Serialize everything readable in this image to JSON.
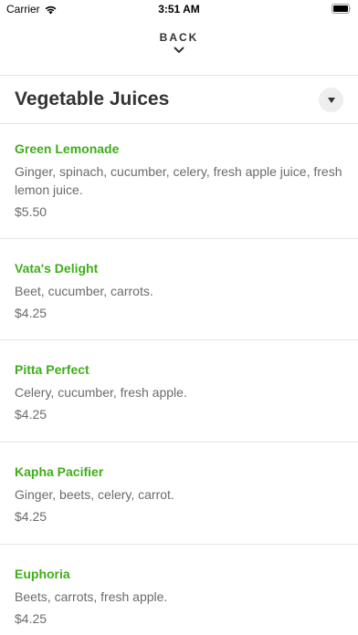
{
  "status_bar": {
    "carrier": "Carrier",
    "time": "3:51 AM"
  },
  "nav": {
    "back_label": "BACK"
  },
  "category": {
    "title": "Vegetable Juices"
  },
  "items": [
    {
      "name": "Green Lemonade",
      "description": "Ginger, spinach, cucumber, celery, fresh apple juice, fresh lemon juice.",
      "price": "$5.50"
    },
    {
      "name": "Vata's Delight",
      "description": "Beet, cucumber, carrots.",
      "price": "$4.25"
    },
    {
      "name": "Pitta Perfect",
      "description": "Celery, cucumber, fresh apple.",
      "price": "$4.25"
    },
    {
      "name": "Kapha Pacifier",
      "description": "Ginger, beets, celery, carrot.",
      "price": "$4.25"
    },
    {
      "name": "Euphoria",
      "description": "Beets, carrots, fresh apple.",
      "price": "$4.25"
    }
  ],
  "colors": {
    "item_name": "#3fad1a",
    "text_muted": "#6b6b6b",
    "divider": "#e6e6e6"
  },
  "icons": [
    "wifi-icon",
    "battery-icon",
    "chevron-down-icon",
    "dropdown-caret-icon"
  ]
}
